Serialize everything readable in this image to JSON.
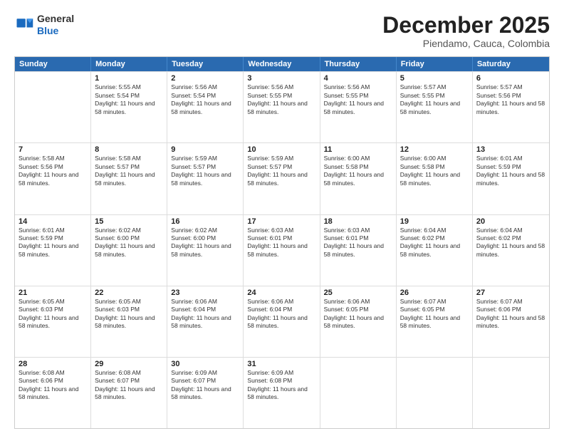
{
  "header": {
    "logo_general": "General",
    "logo_blue": "Blue",
    "month_title": "December 2025",
    "location": "Piendamo, Cauca, Colombia"
  },
  "weekdays": [
    "Sunday",
    "Monday",
    "Tuesday",
    "Wednesday",
    "Thursday",
    "Friday",
    "Saturday"
  ],
  "rows": [
    [
      {
        "day": "",
        "sunrise": "",
        "sunset": "",
        "daylight": ""
      },
      {
        "day": "1",
        "sunrise": "Sunrise: 5:55 AM",
        "sunset": "Sunset: 5:54 PM",
        "daylight": "Daylight: 11 hours and 58 minutes."
      },
      {
        "day": "2",
        "sunrise": "Sunrise: 5:56 AM",
        "sunset": "Sunset: 5:54 PM",
        "daylight": "Daylight: 11 hours and 58 minutes."
      },
      {
        "day": "3",
        "sunrise": "Sunrise: 5:56 AM",
        "sunset": "Sunset: 5:55 PM",
        "daylight": "Daylight: 11 hours and 58 minutes."
      },
      {
        "day": "4",
        "sunrise": "Sunrise: 5:56 AM",
        "sunset": "Sunset: 5:55 PM",
        "daylight": "Daylight: 11 hours and 58 minutes."
      },
      {
        "day": "5",
        "sunrise": "Sunrise: 5:57 AM",
        "sunset": "Sunset: 5:55 PM",
        "daylight": "Daylight: 11 hours and 58 minutes."
      },
      {
        "day": "6",
        "sunrise": "Sunrise: 5:57 AM",
        "sunset": "Sunset: 5:56 PM",
        "daylight": "Daylight: 11 hours and 58 minutes."
      }
    ],
    [
      {
        "day": "7",
        "sunrise": "Sunrise: 5:58 AM",
        "sunset": "Sunset: 5:56 PM",
        "daylight": "Daylight: 11 hours and 58 minutes."
      },
      {
        "day": "8",
        "sunrise": "Sunrise: 5:58 AM",
        "sunset": "Sunset: 5:57 PM",
        "daylight": "Daylight: 11 hours and 58 minutes."
      },
      {
        "day": "9",
        "sunrise": "Sunrise: 5:59 AM",
        "sunset": "Sunset: 5:57 PM",
        "daylight": "Daylight: 11 hours and 58 minutes."
      },
      {
        "day": "10",
        "sunrise": "Sunrise: 5:59 AM",
        "sunset": "Sunset: 5:57 PM",
        "daylight": "Daylight: 11 hours and 58 minutes."
      },
      {
        "day": "11",
        "sunrise": "Sunrise: 6:00 AM",
        "sunset": "Sunset: 5:58 PM",
        "daylight": "Daylight: 11 hours and 58 minutes."
      },
      {
        "day": "12",
        "sunrise": "Sunrise: 6:00 AM",
        "sunset": "Sunset: 5:58 PM",
        "daylight": "Daylight: 11 hours and 58 minutes."
      },
      {
        "day": "13",
        "sunrise": "Sunrise: 6:01 AM",
        "sunset": "Sunset: 5:59 PM",
        "daylight": "Daylight: 11 hours and 58 minutes."
      }
    ],
    [
      {
        "day": "14",
        "sunrise": "Sunrise: 6:01 AM",
        "sunset": "Sunset: 5:59 PM",
        "daylight": "Daylight: 11 hours and 58 minutes."
      },
      {
        "day": "15",
        "sunrise": "Sunrise: 6:02 AM",
        "sunset": "Sunset: 6:00 PM",
        "daylight": "Daylight: 11 hours and 58 minutes."
      },
      {
        "day": "16",
        "sunrise": "Sunrise: 6:02 AM",
        "sunset": "Sunset: 6:00 PM",
        "daylight": "Daylight: 11 hours and 58 minutes."
      },
      {
        "day": "17",
        "sunrise": "Sunrise: 6:03 AM",
        "sunset": "Sunset: 6:01 PM",
        "daylight": "Daylight: 11 hours and 58 minutes."
      },
      {
        "day": "18",
        "sunrise": "Sunrise: 6:03 AM",
        "sunset": "Sunset: 6:01 PM",
        "daylight": "Daylight: 11 hours and 58 minutes."
      },
      {
        "day": "19",
        "sunrise": "Sunrise: 6:04 AM",
        "sunset": "Sunset: 6:02 PM",
        "daylight": "Daylight: 11 hours and 58 minutes."
      },
      {
        "day": "20",
        "sunrise": "Sunrise: 6:04 AM",
        "sunset": "Sunset: 6:02 PM",
        "daylight": "Daylight: 11 hours and 58 minutes."
      }
    ],
    [
      {
        "day": "21",
        "sunrise": "Sunrise: 6:05 AM",
        "sunset": "Sunset: 6:03 PM",
        "daylight": "Daylight: 11 hours and 58 minutes."
      },
      {
        "day": "22",
        "sunrise": "Sunrise: 6:05 AM",
        "sunset": "Sunset: 6:03 PM",
        "daylight": "Daylight: 11 hours and 58 minutes."
      },
      {
        "day": "23",
        "sunrise": "Sunrise: 6:06 AM",
        "sunset": "Sunset: 6:04 PM",
        "daylight": "Daylight: 11 hours and 58 minutes."
      },
      {
        "day": "24",
        "sunrise": "Sunrise: 6:06 AM",
        "sunset": "Sunset: 6:04 PM",
        "daylight": "Daylight: 11 hours and 58 minutes."
      },
      {
        "day": "25",
        "sunrise": "Sunrise: 6:06 AM",
        "sunset": "Sunset: 6:05 PM",
        "daylight": "Daylight: 11 hours and 58 minutes."
      },
      {
        "day": "26",
        "sunrise": "Sunrise: 6:07 AM",
        "sunset": "Sunset: 6:05 PM",
        "daylight": "Daylight: 11 hours and 58 minutes."
      },
      {
        "day": "27",
        "sunrise": "Sunrise: 6:07 AM",
        "sunset": "Sunset: 6:06 PM",
        "daylight": "Daylight: 11 hours and 58 minutes."
      }
    ],
    [
      {
        "day": "28",
        "sunrise": "Sunrise: 6:08 AM",
        "sunset": "Sunset: 6:06 PM",
        "daylight": "Daylight: 11 hours and 58 minutes."
      },
      {
        "day": "29",
        "sunrise": "Sunrise: 6:08 AM",
        "sunset": "Sunset: 6:07 PM",
        "daylight": "Daylight: 11 hours and 58 minutes."
      },
      {
        "day": "30",
        "sunrise": "Sunrise: 6:09 AM",
        "sunset": "Sunset: 6:07 PM",
        "daylight": "Daylight: 11 hours and 58 minutes."
      },
      {
        "day": "31",
        "sunrise": "Sunrise: 6:09 AM",
        "sunset": "Sunset: 6:08 PM",
        "daylight": "Daylight: 11 hours and 58 minutes."
      },
      {
        "day": "",
        "sunrise": "",
        "sunset": "",
        "daylight": ""
      },
      {
        "day": "",
        "sunrise": "",
        "sunset": "",
        "daylight": ""
      },
      {
        "day": "",
        "sunrise": "",
        "sunset": "",
        "daylight": ""
      }
    ]
  ]
}
